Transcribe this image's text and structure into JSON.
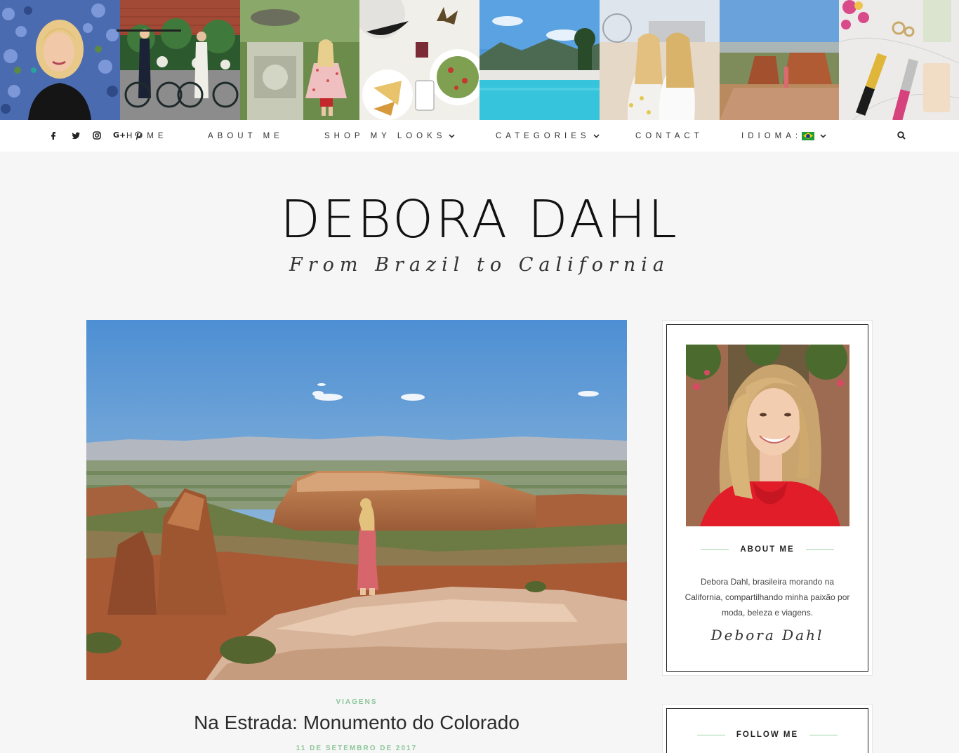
{
  "colors": {
    "accent": "#8cc69a",
    "accent_line": "#9fd3a9",
    "page_bg": "#f6f6f6",
    "text": "#222222"
  },
  "instagram": {
    "tiles": [
      {
        "name": "photo-woman-flowers"
      },
      {
        "name": "photo-bicycles"
      },
      {
        "name": "photo-fountain-dress"
      },
      {
        "name": "photo-food-table"
      },
      {
        "name": "photo-pool-mountains"
      },
      {
        "name": "photo-beach-friends"
      },
      {
        "name": "photo-canyon"
      },
      {
        "name": "photo-makeup-brushes"
      }
    ]
  },
  "social": [
    {
      "icon": "facebook-icon",
      "glyph": "f"
    },
    {
      "icon": "twitter-icon",
      "glyph": "t"
    },
    {
      "icon": "instagram-icon",
      "glyph": "i"
    },
    {
      "icon": "google-plus-icon",
      "glyph": "G+"
    },
    {
      "icon": "pinterest-icon",
      "glyph": "P"
    }
  ],
  "nav": {
    "home": "HOME",
    "about": "ABOUT ME",
    "shop": "SHOP MY LOOKS",
    "categories": "CATEGORIES",
    "contact": "CONTACT",
    "language": "IDIOMA:",
    "language_flag": "brazil-flag-icon",
    "search_icon": "search-icon"
  },
  "header": {
    "title": "DEBORA DAHL",
    "tagline": "From Brazil to California"
  },
  "post": {
    "category": "VIAGENS",
    "title": "Na Estrada: Monumento do Colorado",
    "date": "11 DE SETEMBRO DE 2017"
  },
  "sidebar": {
    "about": {
      "heading": "ABOUT ME",
      "text": "Debora Dahl, brasileira morando na California, compartilhando minha paixão por moda, beleza e viagens.",
      "signature": "Debora Dahl"
    },
    "follow": {
      "heading": "FOLLOW ME"
    }
  }
}
